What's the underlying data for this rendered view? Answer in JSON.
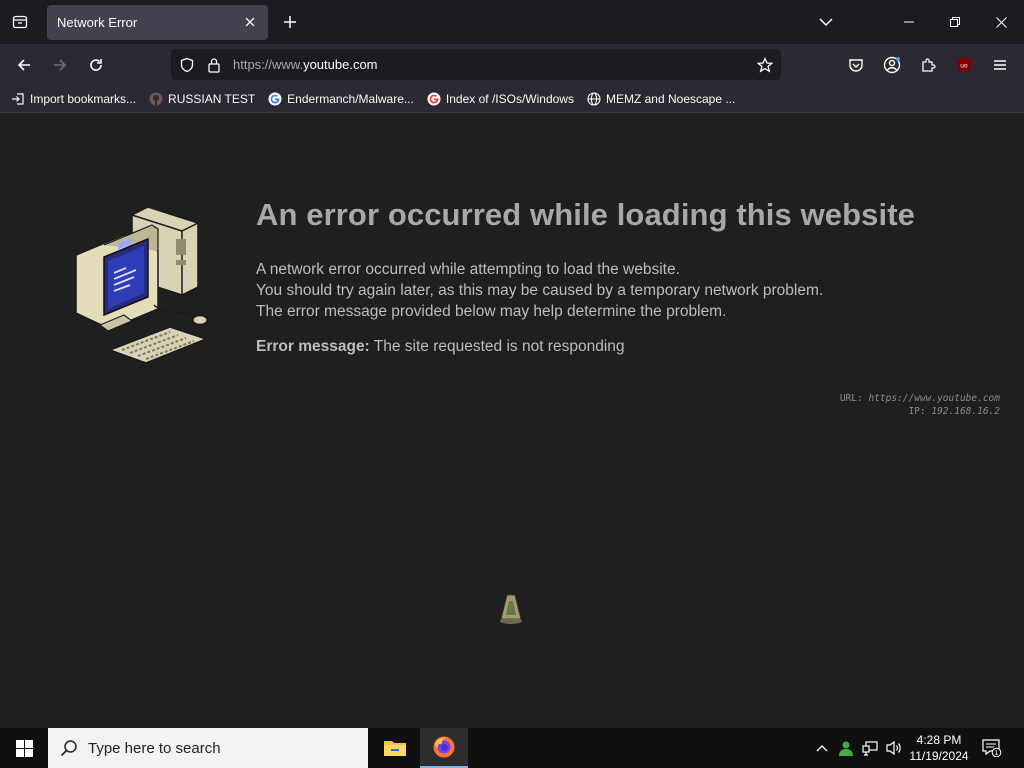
{
  "browser": {
    "tab": {
      "title": "Network Error"
    },
    "url": {
      "prefix": "https://www.",
      "domain": "youtube.com"
    },
    "bookmarks": [
      {
        "label": "Import bookmarks...",
        "icon": "import-icon"
      },
      {
        "label": "RUSSIAN TEST",
        "icon": "github-icon"
      },
      {
        "label": "Endermanch/Malware...",
        "icon": "google-icon"
      },
      {
        "label": "Index of /ISOs/Windows",
        "icon": "google-icon"
      },
      {
        "label": "MEMZ and Noescape ...",
        "icon": "globe-icon"
      }
    ],
    "extension_badge": "uo"
  },
  "page": {
    "title": "An error occurred while loading this website",
    "lines": [
      "A network error occurred while attempting to load the website.",
      "You should try again later, as this may be caused by a temporary network problem.",
      "The error message provided below may help determine the problem."
    ],
    "error_label": "Error message:",
    "error_text": " The site requested is not responding",
    "meta_url_label": "URL: ",
    "meta_url": "https://www.youtube.com",
    "meta_ip_label": "IP: ",
    "meta_ip": "192.168.16.2"
  },
  "taskbar": {
    "search_placeholder": "Type here to search",
    "time": "4:28 PM",
    "date": "11/19/2024",
    "notification_count": "1"
  },
  "colors": {
    "accent": "#76b9ed",
    "tab_active": "#42414d",
    "page_bg": "#1f1f1f",
    "title_gray": "#a8a8a8"
  }
}
